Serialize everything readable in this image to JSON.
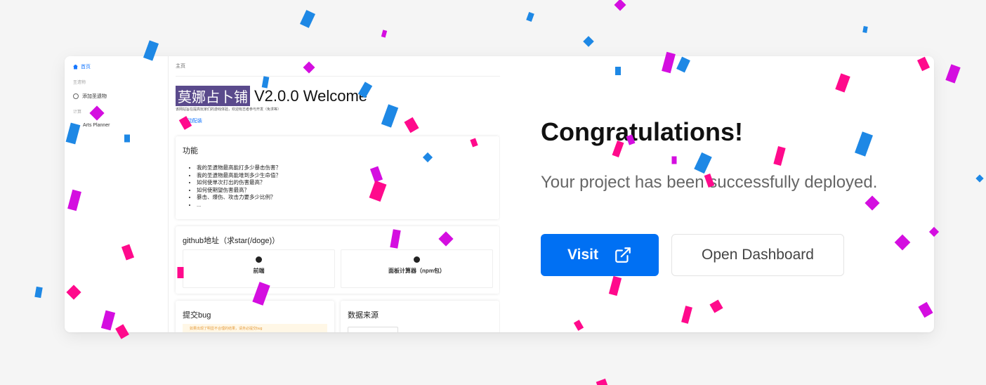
{
  "preview": {
    "sidebar": {
      "home": "首页",
      "group_artifacts": "圣遗物",
      "add_artifact": "添加圣遗物",
      "group_calc": "计算",
      "arts_planner": "Arts Planner"
    },
    "breadcrumb": "主页",
    "title_highlight": "莫娜占卜铺",
    "title_rest": "V2.0.0 Welcome",
    "subtitle": "该网站旨在提高玩家们的游戏体验，欢迎有志者参与开发（免求等）",
    "link": "自动配装",
    "features": {
      "title": "功能",
      "items": [
        "我的圣遗物最高能打多少暴击伤害？",
        "我的圣遗物最高能堆到多少生命值？",
        "如何使单次打出的伤害最高？",
        "如何使期望伤害最高？",
        "暴击、爆伤、攻击力要多少比例？",
        "..."
      ]
    },
    "github": {
      "title": "github地址（求star(/doge)）",
      "frontend": "前端",
      "calculator": "面板计算器（npm包）"
    },
    "bug": {
      "title": "提交bug",
      "warning": "如果出现了明显不合理的结果，请务必提交bug"
    },
    "data_source": {
      "title": "数据来源"
    }
  },
  "heading": "Congratulations!",
  "subtext": "Your project has been successfully deployed.",
  "visit_label": "Visit",
  "dashboard_label": "Open Dashboard",
  "colors": {
    "accent": "#0070f3",
    "confetti": [
      "#1e88e5",
      "#ff0a8c",
      "#d40ee0"
    ]
  }
}
